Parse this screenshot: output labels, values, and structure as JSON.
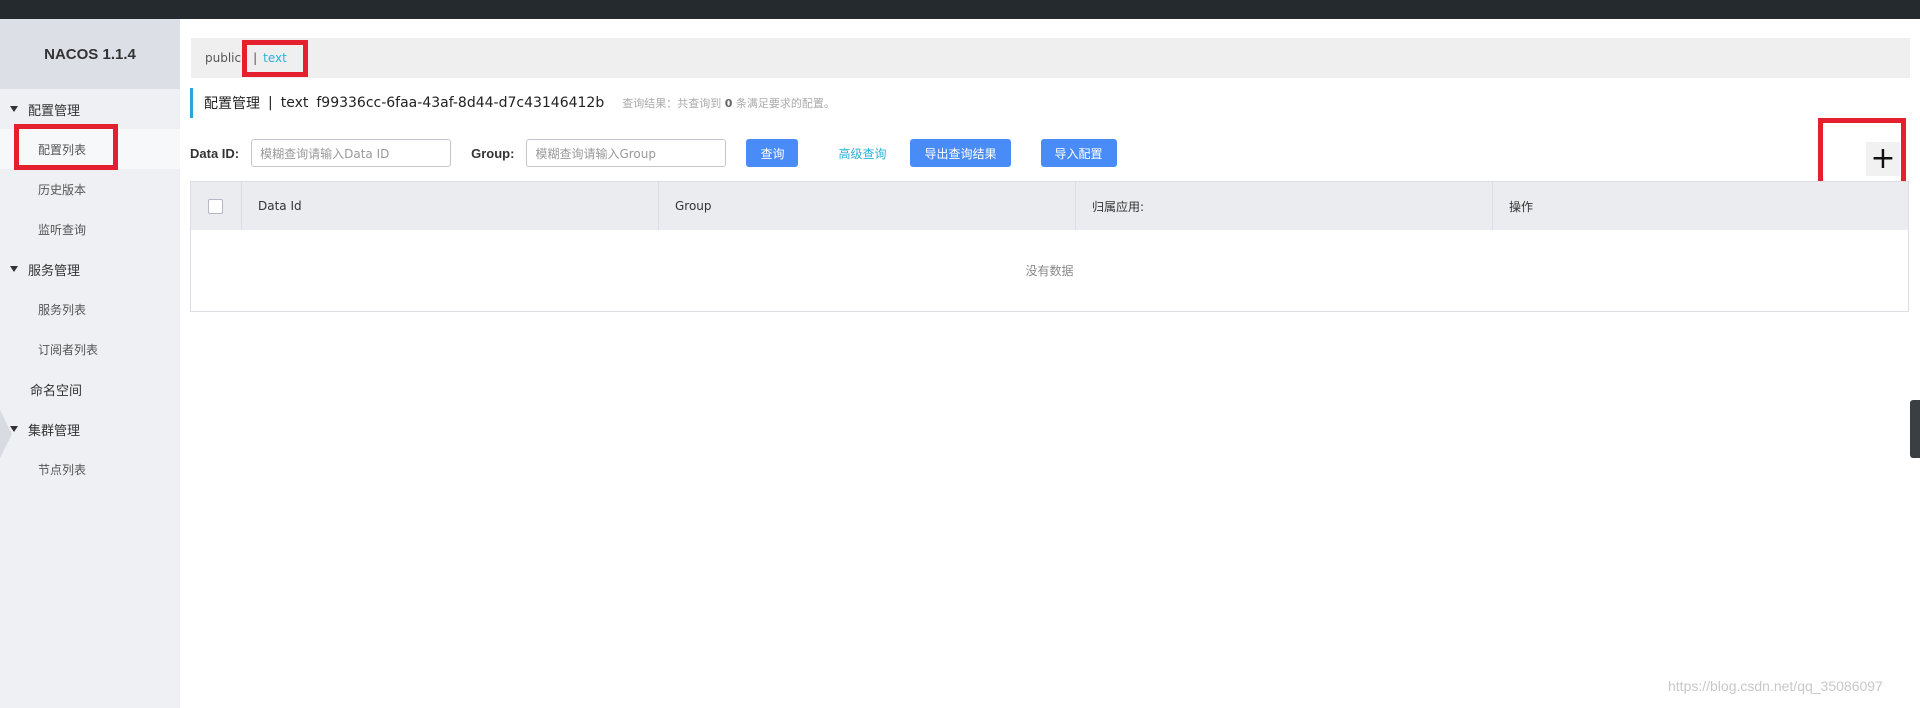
{
  "app": {
    "title": "NACOS 1.1.4"
  },
  "sidebar": {
    "groups": [
      {
        "label": "配置管理",
        "items": [
          "配置列表",
          "历史版本",
          "监听查询"
        ]
      },
      {
        "label": "服务管理",
        "items": [
          "服务列表",
          "订阅者列表"
        ]
      },
      {
        "label": "命名空间"
      },
      {
        "label": "集群管理",
        "items": [
          "节点列表"
        ]
      }
    ]
  },
  "namespaces": {
    "items": [
      "public",
      "text"
    ],
    "separator": "|",
    "active": "text"
  },
  "page": {
    "title": "配置管理",
    "divider": "|",
    "namespace_name": "text",
    "namespace_id": "f99336cc-6faa-43af-8d44-d7c43146412b",
    "result_prefix": "查询结果：共查询到",
    "result_count": "0",
    "result_suffix": "条满足要求的配置。"
  },
  "search": {
    "data_id_label": "Data ID:",
    "data_id_placeholder": "模糊查询请输入Data ID",
    "group_label": "Group:",
    "group_placeholder": "模糊查询请输入Group",
    "query_button": "查询",
    "advanced_link": "高级查询",
    "export_button": "导出查询结果",
    "import_button": "导入配置"
  },
  "add_button": "+",
  "table": {
    "columns": [
      "Data Id",
      "Group",
      "归属应用:",
      "操作"
    ],
    "empty_text": "没有数据"
  },
  "watermark": "https://blog.csdn.net/qq_35086097",
  "colors": {
    "highlight": "#e5202e",
    "primary": "#4a8cf7",
    "link": "#2bb2d6",
    "topbar": "#252a2f"
  }
}
